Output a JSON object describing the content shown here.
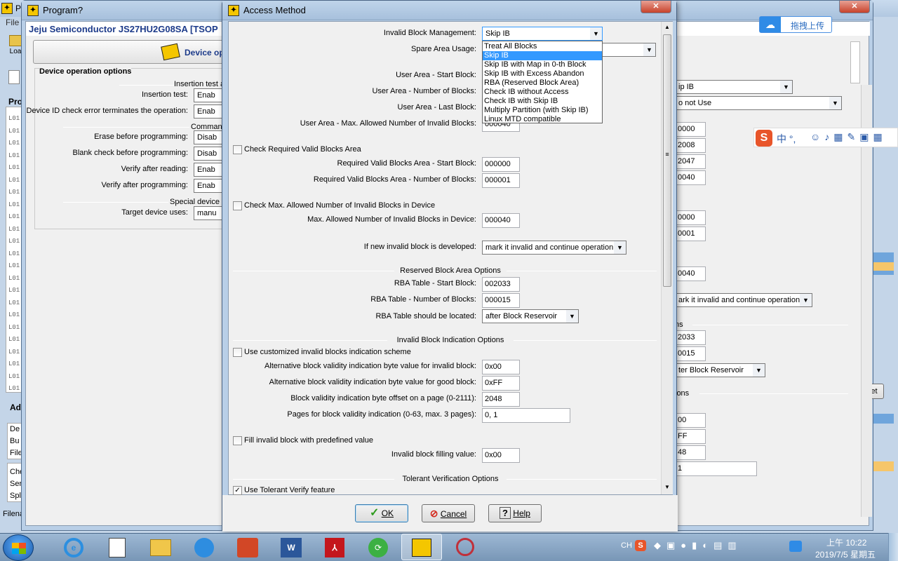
{
  "background_window": {
    "title": "Pr",
    "file_menu": "File",
    "header_text": "Jeju Semiconductor  JS27HU2G08SA [TSOP",
    "load_label": "Loa",
    "device_op_button": "Device op",
    "group_title": "Device operation options",
    "insertion_test_hdr": "Insertion test a",
    "rows": [
      {
        "label": "Insertion test:",
        "value": "Enab"
      },
      {
        "label": "Device ID check error terminates the operation:",
        "value": "Enab"
      },
      {
        "label": "Erase before programming:",
        "value": "Disab"
      },
      {
        "label": "Blank check before programming:",
        "value": "Disab"
      },
      {
        "label": "Verify after reading:",
        "value": "Enab"
      },
      {
        "label": "Verify after programming:",
        "value": "Enab"
      },
      {
        "label": "Target device uses:",
        "value": "manu"
      }
    ],
    "command_hdr": "Comman",
    "special_hdr": "Special device",
    "pro_label": "Pro",
    "log_lines": [
      "L01",
      "L01",
      "L01",
      "L01",
      "L01",
      "L01",
      "L01",
      "L01",
      "L01",
      "L01",
      "L01",
      "L01",
      "L01",
      "L01",
      "L01",
      "L01",
      "L01",
      "L01",
      "L01",
      "L01",
      "L01",
      "L01",
      "L01"
    ],
    "ad_label": "Ad",
    "ad_items": [
      "De",
      "Bu",
      "File"
    ],
    "ch_items": [
      "Che",
      "Ser",
      "Spl"
    ],
    "status_label": "Filena",
    "right_values": {
      "skip_ib": "ip IB",
      "not_use": "o not Use",
      "v1": "0000",
      "v2": "2008",
      "v3": "2047",
      "v4": "0040",
      "v5": "0000",
      "v6": "0001",
      "v7": "0040",
      "invalid_op": "ark it invalid and continue operation",
      "ons1": "ns",
      "v8": "2033",
      "v9": "0015",
      "locate": "ter Block Reservoir",
      "ons2": "ions",
      "v10": "00",
      "v11": "FF",
      "v12": "48",
      "v13": "1",
      "et_btn": "et"
    }
  },
  "program_window": {
    "title": "Program?"
  },
  "baidu": {
    "label": "拖拽上传"
  },
  "sogou": {
    "text": "中 °,"
  },
  "dialog": {
    "title": "Access Method",
    "invalid_block_mgmt": {
      "label": "Invalid Block Management:",
      "value": "Skip IB"
    },
    "dropdown_options": [
      "Treat All Blocks",
      "Skip IB",
      "Skip IB with Map in 0-th Block",
      "Skip IB with Excess Abandon",
      "RBA (Reserved Block Area)",
      "Check IB without Access",
      "Check IB with Skip IB",
      "Multiply Partition (with Skip IB)",
      "Linux MTD compatible"
    ],
    "dropdown_selected_index": 1,
    "spare_area_usage": {
      "label": "Spare Area Usage:"
    },
    "user_area_start": {
      "label": "User Area - Start Block:"
    },
    "user_area_number": {
      "label": "User Area - Number of Blocks:"
    },
    "user_area_last": {
      "label": "User Area - Last Block:"
    },
    "user_area_max": {
      "label": "User Area - Max. Allowed Number of Invalid Blocks:",
      "value": "000040"
    },
    "check_required": {
      "label": "Check Required Valid Blocks Area"
    },
    "req_start": {
      "label": "Required Valid Blocks Area - Start Block:",
      "value": "000000"
    },
    "req_number": {
      "label": "Required Valid Blocks Area - Number of Blocks:",
      "value": "000001"
    },
    "check_max": {
      "label": "Check Max. Allowed Number of Invalid Blocks in Device"
    },
    "max_allowed": {
      "label": "Max. Allowed Number of Invalid Blocks in Device:",
      "value": "000040"
    },
    "new_invalid": {
      "label": "If new invalid block is developed:",
      "value": "mark it invalid and continue operation"
    },
    "rba_section": "Reserved Block Area Options",
    "rba_start": {
      "label": "RBA Table - Start Block:",
      "value": "002033"
    },
    "rba_number": {
      "label": "RBA Table - Number of Blocks:",
      "value": "000015"
    },
    "rba_located": {
      "label": "RBA Table should be located:",
      "value": "after Block Reservoir"
    },
    "ib_section": "Invalid Block Indication Options",
    "use_custom": {
      "label": "Use customized invalid blocks indication scheme"
    },
    "alt_invalid": {
      "label": "Alternative block validity indication byte value for invalid block:",
      "value": "0x00"
    },
    "alt_good": {
      "label": "Alternative block validity indication byte value for good block:",
      "value": "0xFF"
    },
    "byte_offset": {
      "label": "Block validity indication byte offset on a page (0-2111):",
      "value": "2048"
    },
    "pages": {
      "label": "Pages for block validity indication (0-63, max. 3 pages):",
      "value": "0, 1"
    },
    "fill_invalid": {
      "label": "Fill invalid block with predefined value"
    },
    "fill_value": {
      "label": "Invalid block filling value:",
      "value": "0x00"
    },
    "tolerant_section": "Tolerant Verification Options",
    "use_tolerant": {
      "label": "Use Tolerant Verify feature"
    },
    "ok": "OK",
    "cancel": "Cancel",
    "help": "Help"
  },
  "taskbar": {
    "lang": "CH",
    "time": "上午 10:22",
    "date": "2019/7/5 星期五"
  },
  "colors": {
    "accent": "#3399ff",
    "titlebar": "#b9cfe7",
    "desktop": "#9fb4c8"
  }
}
